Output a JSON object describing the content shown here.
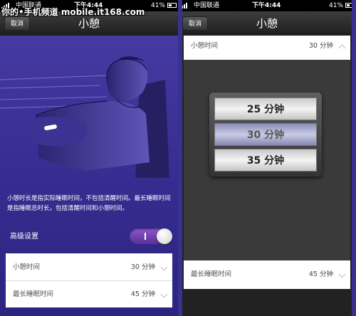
{
  "watermark": "你的•手机频道 mobile.it168.com",
  "status_bar": {
    "carrier": "中国联通",
    "time": "下午4:44",
    "battery": "41%"
  },
  "left_screen": {
    "nav": {
      "cancel_label": "取消",
      "title": "小憩"
    },
    "description": "小憩时长是指实际睡眠时间，不包括清醒时间。最长睡眠时间是指睡眠总时长，包括清醒时间和小憩时间。",
    "advanced_label": "高级设置",
    "advanced_toggle_on": true,
    "rows": [
      {
        "label": "小憩时间",
        "value": "30 分钟"
      },
      {
        "label": "最长睡眠时间",
        "value": "45 分钟"
      }
    ]
  },
  "right_screen": {
    "nav": {
      "cancel_label": "取消",
      "title": "小憩"
    },
    "expanded_row": {
      "label": "小憩时间",
      "value": "30 分钟"
    },
    "picker": [
      "25 分钟",
      "30 分钟",
      "35 分钟"
    ],
    "picker_selected": "30 分钟",
    "bottom_row": {
      "label": "最长睡眠时间",
      "value": "45 分钟"
    }
  },
  "colors": {
    "accent": "#3a2f95",
    "toggle": "#7a4bb8"
  },
  "icons": [
    "signal-icon",
    "wifi-icon",
    "lock-icon",
    "battery-icon",
    "chevron-down-icon",
    "chevron-up-icon"
  ]
}
